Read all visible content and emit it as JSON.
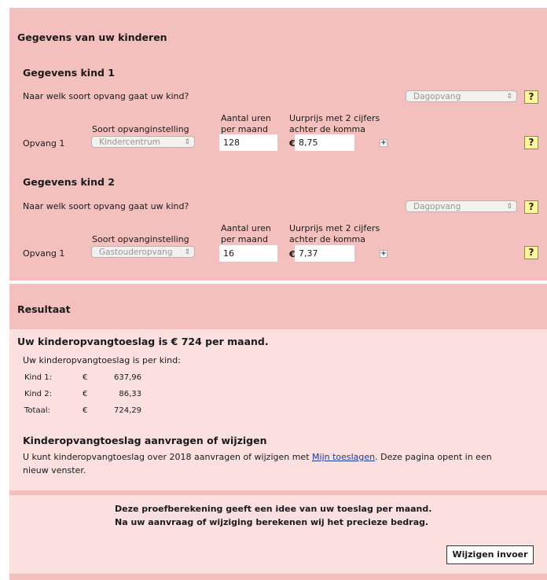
{
  "children_section": {
    "title": "Gegevens van uw kinderen",
    "kids": [
      {
        "title": "Gegevens kind 1",
        "question": "Naar welk soort opvang gaat uw kind?",
        "opvang_type": "Dagopvang",
        "help": "?",
        "col_instelling": "Soort opvanginstelling",
        "col_uren_1": "Aantal uren",
        "col_uren_2": "per maand",
        "col_prijs_1": "Uurprijs met 2 cijfers",
        "col_prijs_2": "achter de komma",
        "row_label": "Opvang 1",
        "instelling": "Kindercentrum",
        "uren": "128",
        "currency": "€",
        "prijs": "8,75",
        "plus": "+"
      },
      {
        "title": "Gegevens kind 2",
        "question": "Naar welk soort opvang gaat uw kind?",
        "opvang_type": "Dagopvang",
        "help": "?",
        "col_instelling": "Soort opvanginstelling",
        "col_uren_1": "Aantal uren",
        "col_uren_2": "per maand",
        "col_prijs_1": "Uurprijs met 2 cijfers",
        "col_prijs_2": "achter de komma",
        "row_label": "Opvang 1",
        "instelling": "Gastouderopvang",
        "uren": "16",
        "currency": "€",
        "prijs": "7,37",
        "plus": "+"
      }
    ]
  },
  "result": {
    "title": "Resultaat",
    "headline": "Uw kinderopvangtoeslag is € 724 per maand.",
    "per_kind": "Uw kinderopvangtoeslag is per kind:",
    "rows": [
      {
        "label": "Kind 1:",
        "cur": "€",
        "value": "637,96"
      },
      {
        "label": "Kind 2:",
        "cur": "€",
        "value": "86,33"
      },
      {
        "label": "Totaal:",
        "cur": "€",
        "value": "724,29"
      }
    ],
    "apply_title": "Kinderopvangtoeslag aanvragen of wijzigen",
    "apply_text_1": "U kunt kinderopvangtoeslag over 2018 aanvragen of wijzigen met ",
    "apply_link": "Mijn toeslagen",
    "apply_text_2": ". Deze pagina opent in een",
    "apply_text_3": "nieuw venster."
  },
  "footer": {
    "line1": "Deze proefberekening geeft een idee van uw toeslag per maand.",
    "line2": "Na uw aanvraag of wijziging berekenen wij het precieze bedrag.",
    "button": "Wijzigen invoer"
  }
}
